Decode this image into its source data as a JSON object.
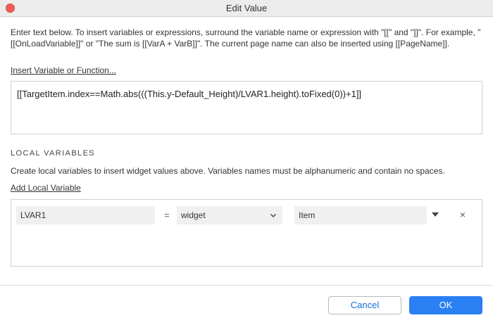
{
  "window": {
    "title": "Edit Value"
  },
  "intro": {
    "text": "Enter text below. To insert variables or expressions, surround the variable name or expression with \"[[\" and \"]]\". For example, \"[[OnLoadVariable]]\" or \"The sum is [[VarA + VarB]]\". The current page name can also be inserted using [[PageName]]."
  },
  "insert_link": "Insert Variable or Function...",
  "expression": "[[TargetItem.index==Math.abs(((This.y-Default_Height)/LVAR1.height).toFixed(0))+1]]",
  "local_vars": {
    "heading": "LOCAL VARIABLES",
    "description": "Create local variables to insert widget values above. Variables names must be alphanumeric and contain no spaces.",
    "add_link": "Add Local Variable",
    "rows": [
      {
        "name": "LVAR1",
        "equals": "=",
        "type": "widget",
        "target": "Item",
        "remove": "×"
      }
    ]
  },
  "buttons": {
    "cancel": "Cancel",
    "ok": "OK"
  },
  "colors": {
    "accent": "#2a7ff3",
    "close": "#ee5f57"
  },
  "icons": {
    "close": "close-window-icon",
    "chevron": "chevron-down-icon",
    "dropdown": "dropdown-triangle-icon",
    "remove": "remove-x-icon"
  }
}
